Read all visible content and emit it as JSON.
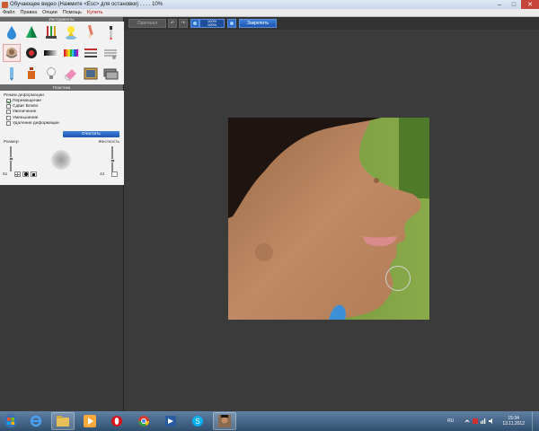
{
  "window": {
    "title": "Обучающее видео (Нажмите <Esc> для остановки) . . . . 10%",
    "controls": {
      "minimize": "–",
      "maximize": "□",
      "close": "✕"
    }
  },
  "menu": {
    "items": [
      "Файл",
      "Правка",
      "Опции",
      "Помощь"
    ],
    "highlight": "Купить"
  },
  "left_panel": {
    "tools_header": "Инструменты",
    "tools": [
      "drop-tool",
      "pyramid-tool",
      "brushes-tool",
      "light-tool",
      "brush-tool",
      "pipette-tool",
      "plastic-tool",
      "blackwhite-tool",
      "gradient-tool",
      "rainbow-tool",
      "layers-tool",
      "lines-tool",
      "tube-tool",
      "bottle-tool",
      "lamp-tool",
      "eraser-tool",
      "photo-tool",
      "stack-tool"
    ],
    "selected_tool": "plastic-tool",
    "plastic_header": "Пластика",
    "mode_label": "Режим деформации",
    "modes": [
      {
        "label": "Перемещение",
        "checked": true
      },
      {
        "label": "Сдвиг Влево",
        "checked": false
      },
      {
        "label": "Увеличение",
        "checked": false
      },
      {
        "label": "Уменьшение",
        "checked": false
      },
      {
        "label": "Удаление деформации",
        "checked": false
      }
    ],
    "clear_button": "Очистить",
    "size_label": "Размер",
    "hardness_label": "Жесткость",
    "size_value": "51",
    "hardness_value": "44",
    "size_level": 0.51,
    "hardness_level": 0.44
  },
  "toolbar": {
    "original_label": "Оригинал",
    "zoom_top": "100%",
    "zoom_bottom": "100%",
    "pin_label": "Закрепить"
  },
  "taskbar": {
    "apps": [
      "windows-start",
      "internet-explorer",
      "file-explorer",
      "media-player",
      "opera",
      "chrome",
      "video-app",
      "skype",
      "photo-editor"
    ],
    "language": "RU",
    "time": "15:34",
    "date": "13.11.2012"
  },
  "colors": {
    "accent_blue": "#2e6ac8",
    "panel_dark": "#3b3b3b",
    "panel_light": "#f2f2f2",
    "close_red": "#c7463b"
  }
}
